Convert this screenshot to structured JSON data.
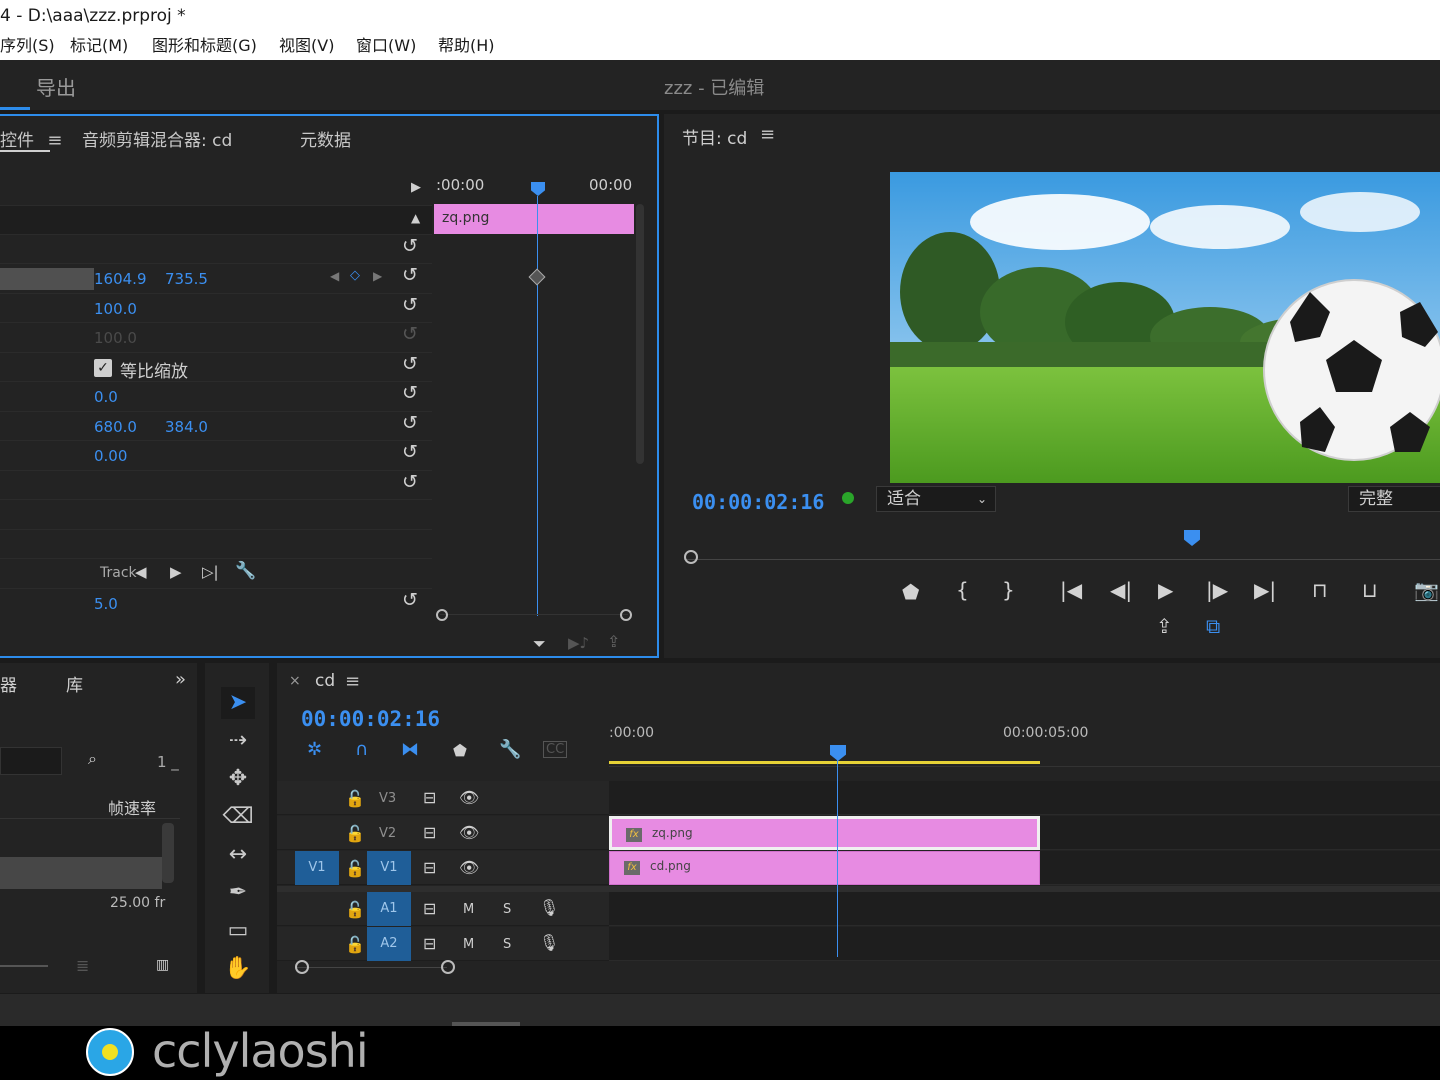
{
  "window": {
    "title": "4 - D:\\aaa\\zzz.prproj *"
  },
  "menu": [
    "序列(S)",
    "标记(M)",
    "图形和标题(G)",
    "视图(V)",
    "窗口(W)",
    "帮助(H)"
  ],
  "workspace": {
    "export_label": "导出",
    "sequence_title": "zzz - 已编辑"
  },
  "effect_controls": {
    "tabs": [
      "控件",
      "音频剪辑混合器: cd",
      "元数据"
    ],
    "timecode_start": ":00:00",
    "timecode_end": "00:00",
    "clip_name": "zq.png",
    "position_x": "1604.9",
    "position_y": "735.5",
    "scale": "100.0",
    "scale_width": "100.0",
    "uniform_scale": "等比缩放",
    "rotation": "0.0",
    "anchor_x": "680.0",
    "anchor_y": "384.0",
    "anti_flicker": "0.00",
    "track_label": "Track",
    "tracking_value": "5.0"
  },
  "program_monitor": {
    "title": "节目: cd",
    "timecode": "00:00:02:16",
    "fit_label": "适合",
    "quality_label": "完整"
  },
  "project_panel": {
    "tab_library": "库",
    "count": "1 _",
    "col_framerate": "帧速率",
    "framerate_value": "25.00 fr"
  },
  "timeline": {
    "sequence_name": "cd",
    "timecode": "00:00:02:16",
    "ruler_start": ":00:00",
    "ruler_mark": "00:00:05:00",
    "tracks": [
      {
        "name": "V3",
        "type": "video"
      },
      {
        "name": "V2",
        "type": "video"
      },
      {
        "name": "V1",
        "type": "video",
        "source": "V1"
      },
      {
        "name": "A1",
        "type": "audio",
        "m": "M",
        "s": "S"
      },
      {
        "name": "A2",
        "type": "audio",
        "m": "M",
        "s": "S"
      }
    ],
    "clips": [
      {
        "name": "zq.png",
        "track": "V2",
        "fx": "fx"
      },
      {
        "name": "cd.png",
        "track": "V1",
        "fx": "fx"
      }
    ]
  },
  "watermark": {
    "text": "cclylaoshi"
  },
  "colors": {
    "accent": "#2d8ceb",
    "clip": "#e78be2",
    "timecode": "#3b8ff0"
  }
}
